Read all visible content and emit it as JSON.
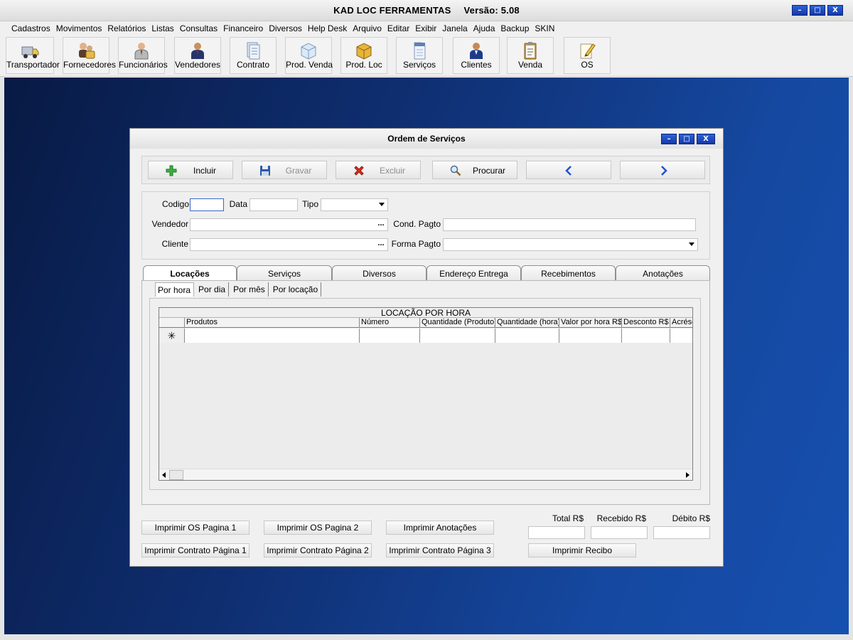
{
  "app": {
    "title": "KAD LOC FERRAMENTAS",
    "version": "Versão: 5.08"
  },
  "window_controls": {
    "minimize": "–",
    "maximize": "□",
    "close": "X"
  },
  "menu": [
    "Cadastros",
    "Movimentos",
    "Relatórios",
    "Listas",
    "Consultas",
    "Financeiro",
    "Diversos",
    "Help Desk",
    "Arquivo",
    "Editar",
    "Exibir",
    "Janela",
    "Ajuda",
    "Backup",
    "SKIN"
  ],
  "toolbar": [
    {
      "label": "Transportador",
      "icon": "truck-icon"
    },
    {
      "label": "Fornecedores",
      "icon": "suppliers-icon"
    },
    {
      "label": "Funcionários",
      "icon": "employee-icon"
    },
    {
      "label": "Vendedores",
      "icon": "salesperson-icon"
    },
    {
      "label": "Contrato",
      "icon": "contract-icon"
    },
    {
      "label": "Prod. Venda",
      "icon": "product-box-icon"
    },
    {
      "label": "Prod. Loc",
      "icon": "rental-box-icon"
    },
    {
      "label": "Serviços",
      "icon": "document-icon"
    },
    {
      "label": "Clientes",
      "icon": "client-icon"
    },
    {
      "label": "Venda",
      "icon": "clipboard-icon"
    },
    {
      "label": "OS",
      "icon": "pencil-note-icon"
    }
  ],
  "dialog": {
    "title": "Ordem de Serviços",
    "actions": [
      {
        "label": "Incluir",
        "icon": "plus-icon",
        "enabled": true
      },
      {
        "label": "Gravar",
        "icon": "save-icon",
        "enabled": false
      },
      {
        "label": "Excluir",
        "icon": "delete-x-icon",
        "enabled": false
      },
      {
        "label": "Procurar",
        "icon": "magnifier-icon",
        "enabled": true
      }
    ],
    "nav": {
      "prev": "chevron-left-icon",
      "next": "chevron-right-icon"
    },
    "form": {
      "codigo_label": "Codigo",
      "codigo_value": "",
      "data_label": "Data",
      "data_value": "",
      "tipo_label": "Tipo",
      "tipo_value": "",
      "vendedor_label": "Vendedor",
      "vendedor_value": "",
      "cliente_label": "Cliente",
      "cliente_value": "",
      "cond_pagto_label": "Cond. Pagto",
      "cond_pagto_value": "",
      "forma_pagto_label": "Forma Pagto",
      "forma_pagto_value": "",
      "ellipsis": "..."
    },
    "tabs": [
      "Locações",
      "Serviços",
      "Diversos",
      "Endereço Entrega",
      "Recebimentos",
      "Anotações"
    ],
    "active_tab": 0,
    "subtabs": [
      "Por hora",
      "Por dia",
      "Por mês",
      "Por locação"
    ],
    "active_subtab": 0,
    "grid": {
      "caption": "LOCAÇÃO POR HORA",
      "columns": [
        "Produtos",
        "Número",
        "Quantidade (Produto)",
        "Quantidade (hora)",
        "Valor por hora R$",
        "Desconto R$",
        "Acrésc"
      ],
      "new_row_marker": "✳"
    },
    "print_buttons": {
      "os_p1": "Imprimir OS Pagina 1",
      "os_p2": "Imprimir OS Pagina 2",
      "anotacoes": "Imprimir Anotações",
      "contrato_p1": "Imprimir Contrato Página 1",
      "contrato_p2": "Imprimir Contrato Página 2",
      "contrato_p3": "Imprimir Contrato Página 3",
      "recibo": "Imprimir Recibo"
    },
    "totals": {
      "total_label": "Total R$",
      "total_value": "",
      "recebido_label": "Recebido R$",
      "recebido_value": "",
      "debito_label": "Débito R$",
      "debito_value": ""
    }
  },
  "colors": {
    "desktop_dark": "#081a44",
    "desktop_light": "#1650b0",
    "window_button": "#1f4ac0"
  }
}
